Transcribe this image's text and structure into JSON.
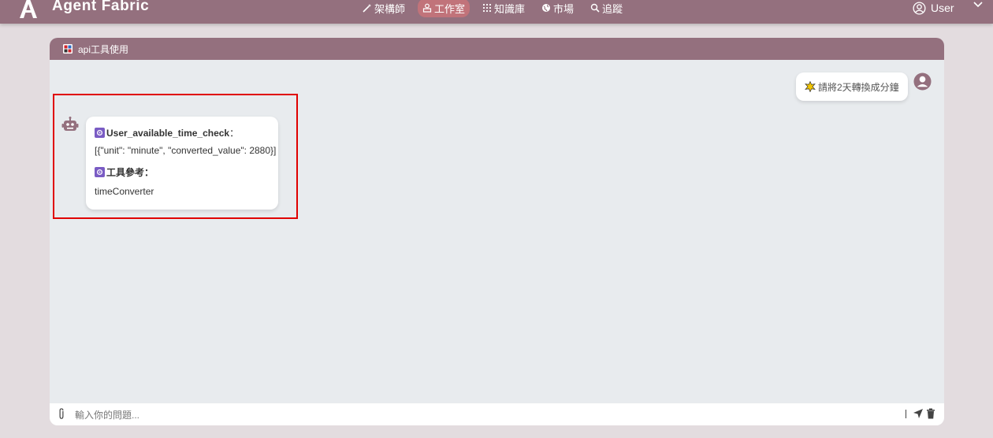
{
  "app": {
    "brand": "Agent Fabric"
  },
  "nav": {
    "items": [
      {
        "label": "架構師",
        "icon": "wand-icon"
      },
      {
        "label": "工作室",
        "icon": "studio-icon",
        "active": true
      },
      {
        "label": "知識庫",
        "icon": "grid-icon"
      },
      {
        "label": "市場",
        "icon": "globe-icon"
      },
      {
        "label": "追蹤",
        "icon": "search-icon"
      }
    ],
    "user_label": "User"
  },
  "panel": {
    "title": "api工具使用"
  },
  "chat": {
    "user_message": "請將2天轉換成分鐘",
    "bot": {
      "tool_name": "User_available_time_check",
      "tool_suffix": "：",
      "result": "[{\"unit\": \"minute\", \"converted_value\": 2880}]",
      "ref_label": "工具參考：",
      "ref_value": "timeConverter"
    }
  },
  "input": {
    "placeholder": "輸入你的問題..."
  },
  "colors": {
    "header": "#94707e",
    "active_tab": "#c1737a",
    "highlight": "#e00000"
  }
}
